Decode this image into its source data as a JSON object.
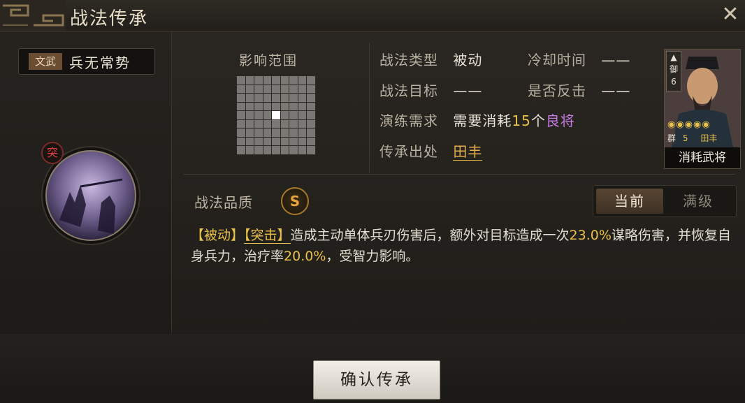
{
  "window": {
    "title": "战法传承"
  },
  "skill": {
    "type_tag": "文武",
    "name": "兵无常势",
    "badge": "突"
  },
  "range": {
    "label": "影响范围"
  },
  "info": {
    "type_label": "战法类型",
    "type_value": "被动",
    "cooldown_label": "冷却时间",
    "cooldown_value": "——",
    "target_label": "战法目标",
    "target_value": "——",
    "counter_label": "是否反击",
    "counter_value": "——",
    "training_label": "演练需求",
    "training_prefix": "需要消耗",
    "training_count": "15",
    "training_unit": "个",
    "training_item": "良将",
    "source_label": "传承出处",
    "source_value": "田丰"
  },
  "general_card": {
    "unit_type": "御",
    "cost": "6",
    "faction": "群",
    "level": "5",
    "name": "田丰",
    "stars": "5",
    "footer": "消耗武将"
  },
  "quality": {
    "label": "战法品质",
    "grade": "S"
  },
  "toggle": {
    "current": "当前",
    "max": "满级"
  },
  "description": {
    "tag1": "【被动】",
    "tag2": "【突击】",
    "text1": "造成主动单体兵刃伤害后，额外对目标造成一次",
    "pct1": "23.0%",
    "text2": "谋略伤害，并恢复自身兵力，治疗率",
    "pct2": "20.0%",
    "text3": "，受智力影响。"
  },
  "confirm_button": "确认传承",
  "colors": {
    "accent_gold": "#e9c04a",
    "purple": "#c47be0",
    "background": "#1c1a17"
  }
}
